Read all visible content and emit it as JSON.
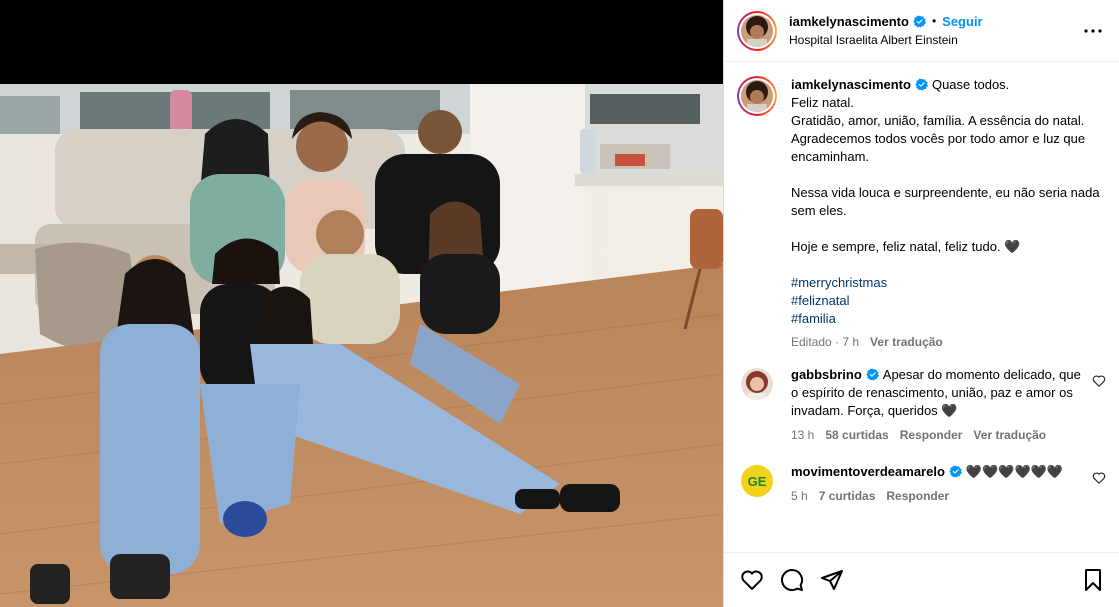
{
  "post": {
    "author": {
      "username": "iamkelynascimento",
      "verified": true,
      "follow_label": "Seguir",
      "location": "Hospital Israelita Albert Einstein"
    },
    "caption": {
      "first_line": "Quase todos.",
      "paragraph1": "Feliz natal.\nGratidão, amor, união, família. A essência do natal. Agradecemos todos vocês por todo amor e luz que encaminham.",
      "paragraph2": "Nessa vida louca e surpreendente, eu não seria nada sem eles.",
      "paragraph3": "Hoje e sempre, feliz natal, feliz tudo. 🖤",
      "hashtags": [
        "#merrychristmas",
        "#feliznatal",
        "#familia"
      ],
      "edited_time": "Editado · 7 h",
      "see_translation": "Ver tradução"
    },
    "comments": [
      {
        "username": "gabbsbrino",
        "verified": true,
        "text": "Apesar do momento delicado, que o espírito de renascimento, união, paz e amor os invadam. Força, queridos 🖤",
        "time": "13 h",
        "likes": "58 curtidas",
        "reply": "Responder",
        "translate": "Ver tradução"
      },
      {
        "username": "movimentoverdeamarelo",
        "verified": true,
        "text": "🖤🖤🖤🖤🖤🖤",
        "time": "5 h",
        "likes": "7 curtidas",
        "reply": "Responder",
        "translate": ""
      }
    ],
    "icons": {
      "more": "more-options-icon",
      "like": "heart-icon",
      "comment": "comment-bubble-icon",
      "share": "paper-plane-icon",
      "save": "bookmark-icon"
    },
    "colors": {
      "follow": "#0095f6",
      "verified": "#0095f6",
      "hashtag": "#00376b",
      "meta": "#737373"
    }
  }
}
